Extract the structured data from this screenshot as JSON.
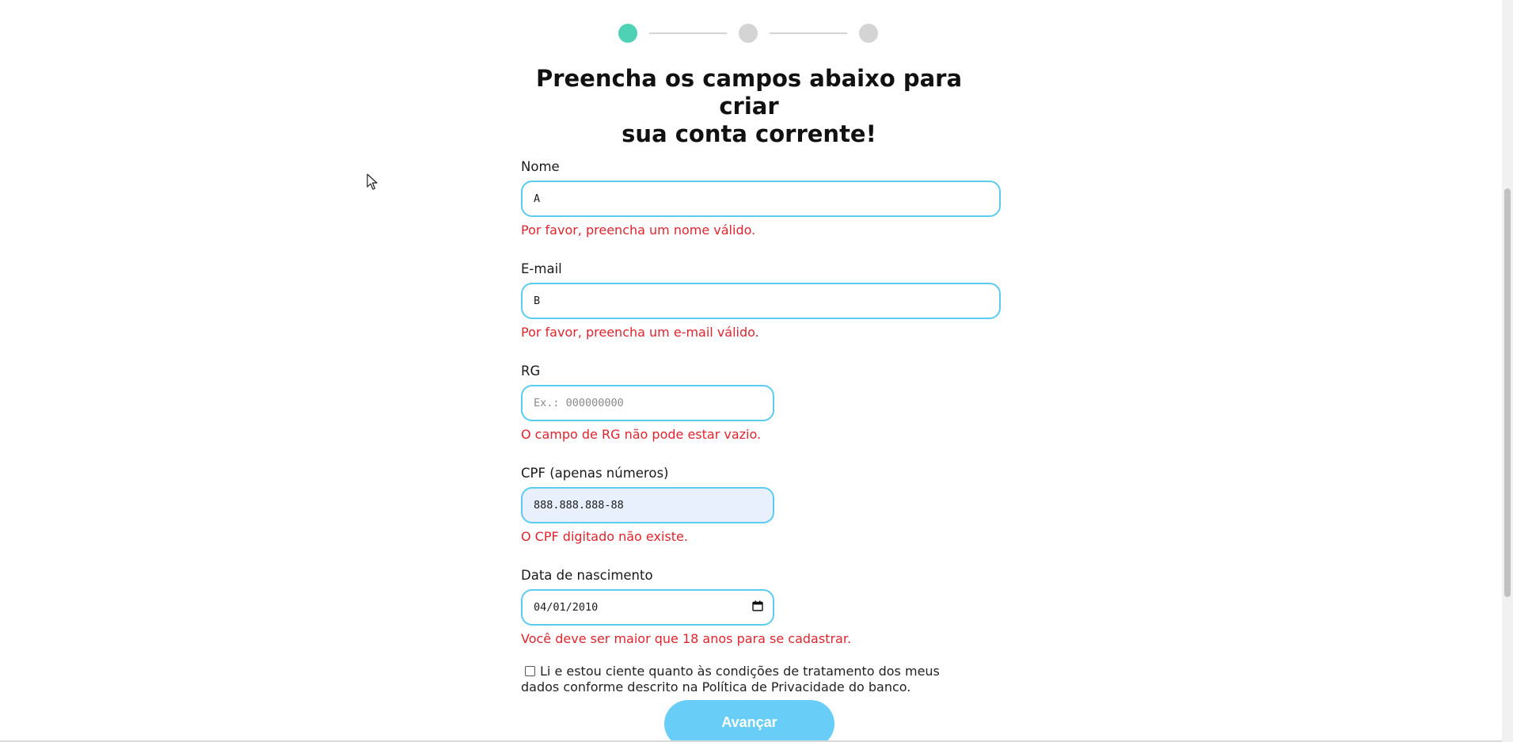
{
  "stepper": {
    "steps": [
      "step-1",
      "step-2",
      "step-3"
    ],
    "active_step": 1,
    "active_color": "#4fd1b5",
    "inactive_color": "#d4d4d4"
  },
  "title": {
    "line1": "Preencha os campos abaixo para criar",
    "line2": "sua conta corrente!"
  },
  "form": {
    "name": {
      "label": "Nome",
      "value": "A",
      "error": "Por favor, preencha um nome válido."
    },
    "email": {
      "label": "E-mail",
      "value": "B",
      "error": "Por favor, preencha um e-mail válido."
    },
    "rg": {
      "label": "RG",
      "value": "",
      "placeholder": "Ex.: 000000000",
      "error": "O campo de RG não pode estar vazio."
    },
    "cpf": {
      "label": "CPF (apenas números)",
      "value": "888.888.888-88",
      "error": "O CPF digitado não existe."
    },
    "birthdate": {
      "label": "Data de nascimento",
      "value": "04/01/2010",
      "error": "Você deve ser maior que 18 anos para se cadastrar."
    },
    "consent": {
      "checked": false,
      "text": "Li e estou ciente quanto às condições de tratamento dos meus dados conforme descrito na Política de Privacidade do banco."
    },
    "submit_label": "Avançar"
  },
  "colors": {
    "input_border": "#5ccbf0",
    "error": "#e0242e",
    "button": "#68cdf7",
    "autofill_bg": "#e8f0fe"
  }
}
